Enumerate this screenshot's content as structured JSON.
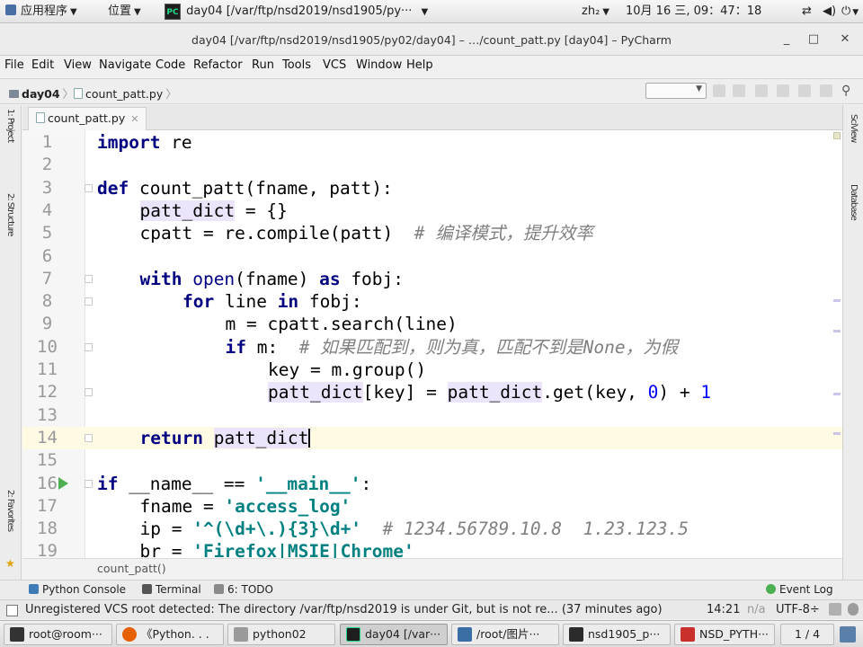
{
  "top_panel": {
    "apps_menu": "应用程序",
    "places_menu": "位置",
    "active_window": "day04 [/var/ftp/nsd2019/nsd1905/py···",
    "keyboard_layout": "zh₂",
    "clock": "10月 16 三, 09：47：18"
  },
  "window": {
    "title": "day04 [/var/ftp/nsd2019/nsd1905/py02/day04] – …/count_patt.py [day04] – PyCharm"
  },
  "menu": {
    "items": [
      "File",
      "Edit",
      "View",
      "Navigate",
      "Code",
      "Refactor",
      "Run",
      "Tools",
      "VCS",
      "Window",
      "Help"
    ]
  },
  "nav_bar": {
    "project": "day04",
    "file": "count_patt.py"
  },
  "left_strip": {
    "tab_1": "1: Project",
    "tab_2": "2: Structure",
    "tab_3": "2: Favorites"
  },
  "right_strip": {
    "tab_1": "SciView",
    "tab_2": "Database"
  },
  "editor": {
    "tab_label": "count_patt.py",
    "current_line": 14,
    "lines": [
      {
        "num": "1"
      },
      {
        "num": "2"
      },
      {
        "num": "3"
      },
      {
        "num": "4"
      },
      {
        "num": "5"
      },
      {
        "num": "6"
      },
      {
        "num": "7"
      },
      {
        "num": "8"
      },
      {
        "num": "9"
      },
      {
        "num": "10"
      },
      {
        "num": "11"
      },
      {
        "num": "12"
      },
      {
        "num": "13"
      },
      {
        "num": "14"
      },
      {
        "num": "15"
      },
      {
        "num": "16"
      },
      {
        "num": "17"
      },
      {
        "num": "18"
      },
      {
        "num": "19"
      }
    ],
    "code": {
      "l1_kw": "import",
      "l1_rest": " re",
      "l3_kw": "def",
      "l3_rest": " count_patt(fname, patt):",
      "l4_var": "patt_dict",
      "l4_rest": " = {}",
      "l5_code": "cpatt = re.compile(patt)  ",
      "l5_comment": "# 编译模式，提升效率",
      "l7_kw1": "with",
      "l7_bi": " open",
      "l7_mid": "(fname) ",
      "l7_kw2": "as",
      "l7_rest": " fobj:",
      "l8_kw1": "for",
      "l8_mid": " line ",
      "l8_kw2": "in",
      "l8_rest": " fobj:",
      "l9_code": "m = cpatt.search(line)",
      "l10_kw": "if",
      "l10_rest": " m:  ",
      "l10_comment": "# 如果匹配到，则为真，匹配不到是None，为假",
      "l11_code": "key = m.group()",
      "l12_var1": "patt_dict",
      "l12_mid": "[key] = ",
      "l12_var2": "patt_dict",
      "l12_rest": ".get(key, ",
      "l12_num1": "0",
      "l12_rest2": ") + ",
      "l12_num2": "1",
      "l14_kw": "return",
      "l14_sp": " ",
      "l14_var": "patt_dict",
      "l16_kw": "if",
      "l16_mid": " __name__ == ",
      "l16_str": "'__main__'",
      "l16_rest": ":",
      "l17_code": "fname = ",
      "l17_str": "'access_log'",
      "l18_code": "ip = ",
      "l18_str": "'^(\\d+\\.){3}\\d+'",
      "l18_sp": "  ",
      "l18_comment": "# 1234.56789.10.8  1.23.123.5",
      "l19_code": "br = ",
      "l19_str": "'Firefox|MSIE|Chrome'"
    },
    "breadcrumb": "count_patt()"
  },
  "tool_windows": {
    "python_console": "Python Console",
    "terminal": "Terminal",
    "todo": "6: TODO",
    "event_log": "Event Log"
  },
  "status_bar": {
    "message": "Unregistered VCS root detected: The directory /var/ftp/nsd2019 is under Git, but is not re... (37 minutes ago)",
    "position": "14:21",
    "line_sep": "n/a",
    "encoding": "UTF-8÷"
  },
  "taskbar": {
    "items": [
      {
        "label": "root@room···"
      },
      {
        "label": "《Python. . ."
      },
      {
        "label": "python02"
      },
      {
        "label": "day04 [/var···"
      },
      {
        "label": "/root/图片···"
      },
      {
        "label": "nsd1905_p···"
      },
      {
        "label": "NSD_PYTH···"
      }
    ],
    "workspace": "1 / 4"
  },
  "colors": {
    "keyword": "#000080",
    "string": "#008080",
    "number": "#0000ff",
    "comment": "#808080",
    "highlight": "#ece4fb",
    "current_line": "#fffae3"
  }
}
